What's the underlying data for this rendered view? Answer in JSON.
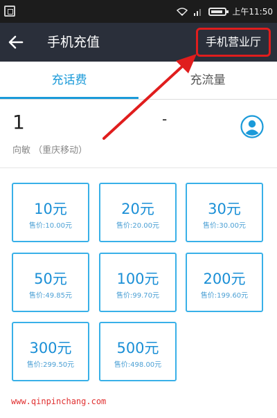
{
  "status_bar": {
    "time": "上午11:50"
  },
  "app_bar": {
    "back_icon": "arrow-left-icon",
    "title": "手机充值",
    "hall_button": "手机营业厅"
  },
  "tabs": [
    {
      "label": "充话费",
      "active": true
    },
    {
      "label": "充流量",
      "active": false
    }
  ],
  "account": {
    "number": "1",
    "dash": "-",
    "name": "向敏 （重庆移动）",
    "contact_icon": "contact-icon"
  },
  "options": [
    {
      "amount": "10元",
      "price": "售价:10.00元"
    },
    {
      "amount": "20元",
      "price": "售价:20.00元"
    },
    {
      "amount": "30元",
      "price": "售价:30.00元"
    },
    {
      "amount": "50元",
      "price": "售价:49.85元"
    },
    {
      "amount": "100元",
      "price": "售价:99.70元"
    },
    {
      "amount": "200元",
      "price": "售价:199.60元"
    },
    {
      "amount": "300元",
      "price": "售价:299.50元"
    },
    {
      "amount": "500元",
      "price": "售价:498.00元"
    }
  ],
  "watermark": "www.qinpinchang.com",
  "colors": {
    "accent": "#1a9ad9",
    "app_bar": "#2a2f3a",
    "highlight": "#e01d1d"
  }
}
